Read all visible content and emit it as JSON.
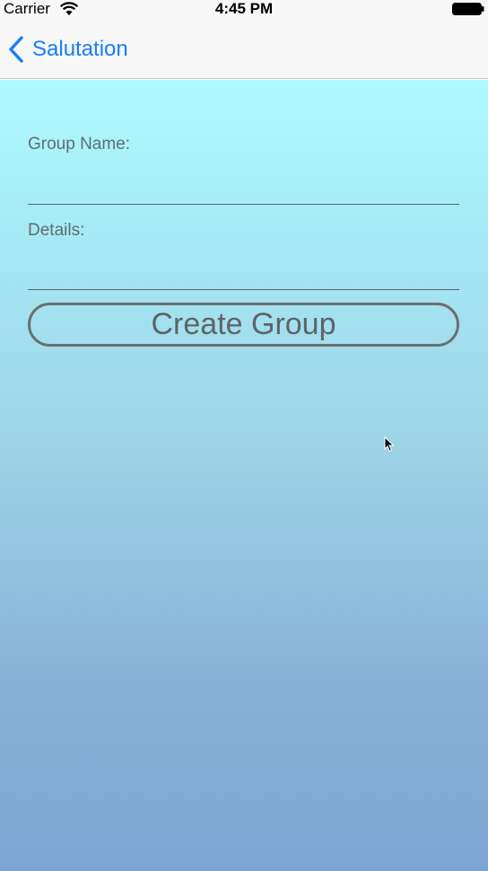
{
  "status_bar": {
    "carrier": "Carrier",
    "wifi_icon": "wifi-icon",
    "time": "4:45 PM",
    "battery_icon": "battery-icon"
  },
  "nav": {
    "back_icon": "chevron-left-icon",
    "back_label": "Salutation",
    "tint_color": "#147efb"
  },
  "form": {
    "group_name": {
      "label": "Group Name:",
      "value": "",
      "placeholder": ""
    },
    "details": {
      "label": "Details:",
      "value": "",
      "placeholder": ""
    },
    "create_button_label": "Create Group"
  },
  "colors": {
    "background_top": "#adfafe",
    "background_bottom": "#7ba6d2"
  }
}
